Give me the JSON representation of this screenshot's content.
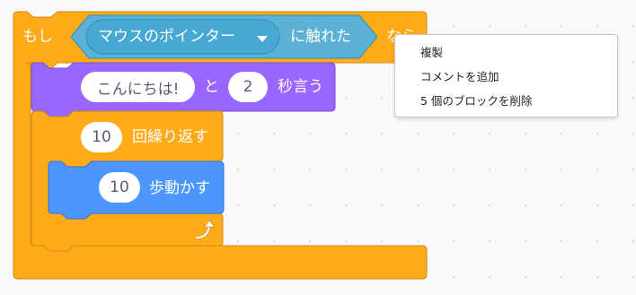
{
  "if_block": {
    "if_label": "もし",
    "then_label": "なら",
    "touching_block": {
      "dropdown_value": "マウスのポインター",
      "label": "に触れた"
    }
  },
  "say_block": {
    "message": "こんにちは!",
    "and_label": "と",
    "seconds": "2",
    "suffix_label": "秒言う"
  },
  "repeat_block": {
    "count": "10",
    "label": "回繰り返す"
  },
  "move_block": {
    "steps": "10",
    "label": "歩動かす"
  },
  "context_menu": {
    "items": [
      {
        "label": "複製"
      },
      {
        "label": "コメントを追加"
      },
      {
        "label": "5 個のブロックを削除"
      }
    ]
  },
  "colors": {
    "control": "#ffab19",
    "control_dark": "#cf8b17",
    "sensing": "#5cb1d6",
    "sensing_dark": "#2e8eb8",
    "looks": "#9966ff",
    "looks_dark": "#774dcb",
    "motion": "#4c97ff",
    "motion_dark": "#3373cc"
  },
  "icons": {
    "loop_arrow": "loop-arrow-icon",
    "dropdown_caret": "dropdown-caret-icon"
  }
}
